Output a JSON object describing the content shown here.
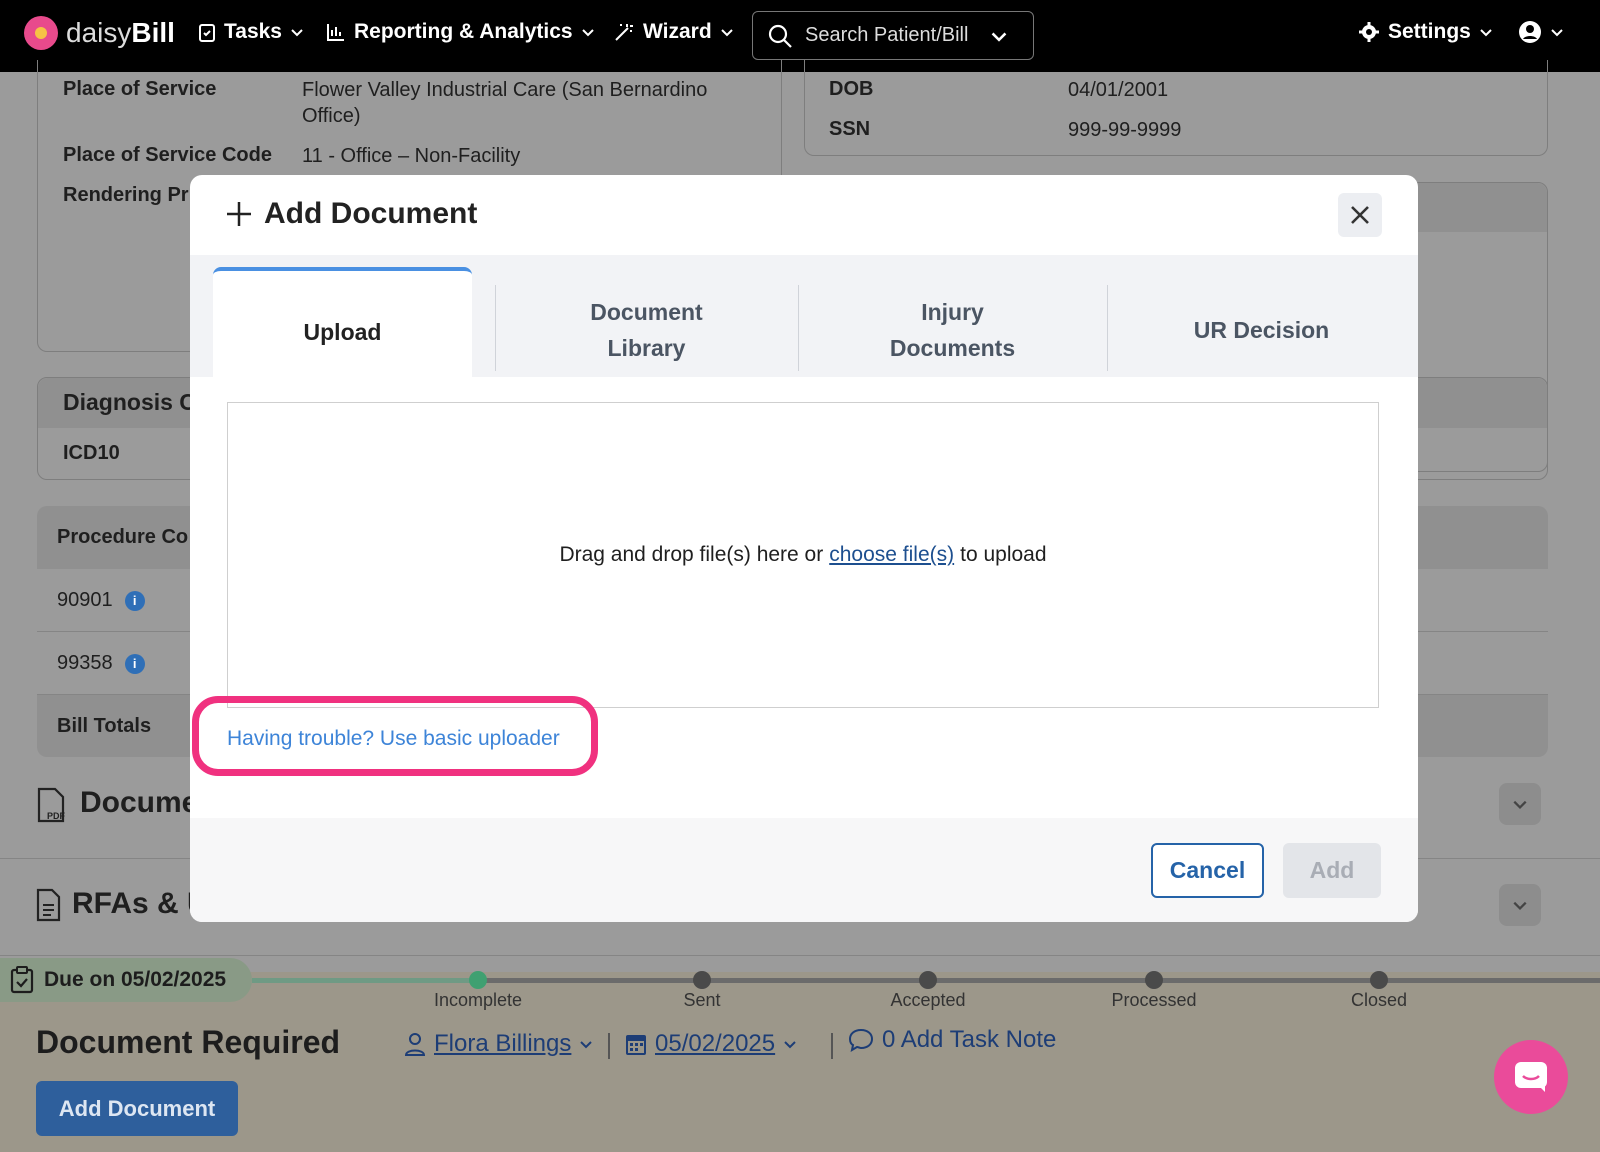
{
  "nav": {
    "brand_light": "daisy",
    "brand_bold": "Bill",
    "tasks": "Tasks",
    "reporting": "Reporting & Analytics",
    "wizard": "Wizard",
    "search_placeholder": "Search Patient/Bill",
    "settings": "Settings"
  },
  "background": {
    "place_of_service_label": "Place of Service",
    "place_of_service_value": "Flower Valley Industrial Care (San Bernardino Office)",
    "pos_code_label": "Place of Service Code",
    "pos_code_value": "11 - Office – Non-Facility",
    "rendering_label": "Rendering Pr",
    "dob_label": "DOB",
    "dob_value": "04/01/2001",
    "ssn_label": "SSN",
    "ssn_value": "999-99-9999",
    "diagnosis_label": "Diagnosis C",
    "icd10_label": "ICD10",
    "procedure_label": "Procedure Co",
    "codes": [
      "90901",
      "99358"
    ],
    "bill_totals": "Bill Totals",
    "documents_title": "Docume",
    "rfas_title": "RFAs & U"
  },
  "task": {
    "due": "Due on 05/02/2025",
    "steps": [
      "Incomplete",
      "Sent",
      "Accepted",
      "Processed",
      "Closed"
    ],
    "current_step": "Incomplete",
    "title": "Document Required",
    "assignee": "Flora Billings",
    "date": "05/02/2025",
    "note": "0 Add Task Note",
    "button": "Add Document"
  },
  "modal": {
    "title": "Add Document",
    "tabs": [
      {
        "label": "Upload"
      },
      {
        "label": "Document Library"
      },
      {
        "label": "Injury Documents"
      },
      {
        "label": "UR Decision"
      }
    ],
    "active_tab": "Upload",
    "drop_prefix": "Drag and drop file(s) here or",
    "drop_link": "choose file(s)",
    "drop_suffix": "to upload",
    "basic_uploader": "Having trouble? Use basic uploader",
    "cancel": "Cancel",
    "add": "Add"
  },
  "colors": {
    "highlight": "#f0317f",
    "active_tab_accent": "#4a90e2",
    "primary": "#2563a8",
    "link": "#3d84d8"
  }
}
